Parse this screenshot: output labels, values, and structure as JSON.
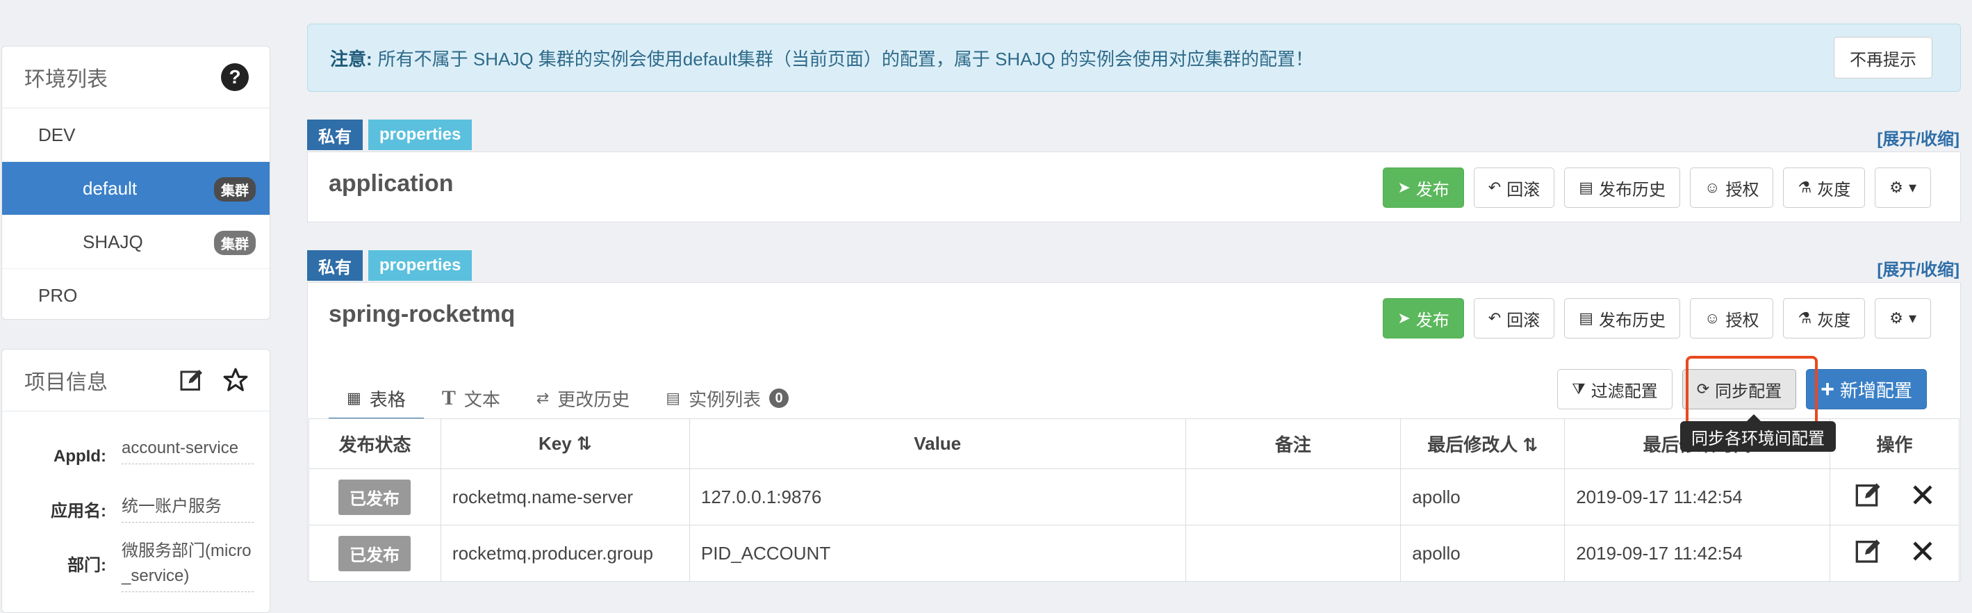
{
  "env_panel": {
    "title": "环境列表",
    "items": [
      {
        "label": "DEV",
        "level": 1
      },
      {
        "label": "default",
        "level": 2,
        "badge": "集群",
        "active": true
      },
      {
        "label": "SHAJQ",
        "level": 2,
        "badge": "集群"
      },
      {
        "label": "PRO",
        "level": 1
      }
    ]
  },
  "project_panel": {
    "title": "项目信息",
    "rows": [
      {
        "label": "AppId:",
        "value": "account-service"
      },
      {
        "label": "应用名:",
        "value": "统一账户服务"
      },
      {
        "label": "部门:",
        "value": "微服务部门(micro_service)"
      }
    ]
  },
  "notice": {
    "prefix": "注意:",
    "text": "所有不属于 SHAJQ 集群的实例会使用default集群（当前页面）的配置，属于 SHAJQ 的实例会使用对应集群的配置！",
    "dismiss_label": "不再提示"
  },
  "namespaces": [
    {
      "tag_private": "私有",
      "tag_format": "properties",
      "expand": "[展开/收缩]",
      "title": "application"
    },
    {
      "tag_private": "私有",
      "tag_format": "properties",
      "expand": "[展开/收缩]",
      "title": "spring-rocketmq"
    }
  ],
  "ns_buttons": {
    "publish": "发布",
    "rollback": "回滚",
    "history": "发布历史",
    "auth": "授权",
    "gray": "灰度"
  },
  "tabs": [
    {
      "label": "表格",
      "active": true
    },
    {
      "label": "文本"
    },
    {
      "label": "更改历史"
    },
    {
      "label": "实例列表",
      "count": "0"
    }
  ],
  "table_actions": {
    "filter": "过滤配置",
    "sync": "同步配置",
    "add": "新增配置",
    "tooltip": "同步各环境间配置"
  },
  "table": {
    "headers": [
      "发布状态",
      "Key",
      "Value",
      "备注",
      "最后修改人",
      "最后修改时间",
      "操作"
    ],
    "rows": [
      {
        "status": "已发布",
        "key": "rocketmq.name-server",
        "value": "127.0.0.1:9876",
        "comment": "",
        "modifier": "apollo",
        "time": "2019-09-17 11:42:54"
      },
      {
        "status": "已发布",
        "key": "rocketmq.producer.group",
        "value": "PID_ACCOUNT",
        "comment": "",
        "modifier": "apollo",
        "time": "2019-09-17 11:42:54"
      }
    ]
  },
  "colors": {
    "accent": "#3b80c9",
    "publish_green": "#5cb85c",
    "highlight": "#e8491e",
    "tag_info": "#5bc0de"
  }
}
